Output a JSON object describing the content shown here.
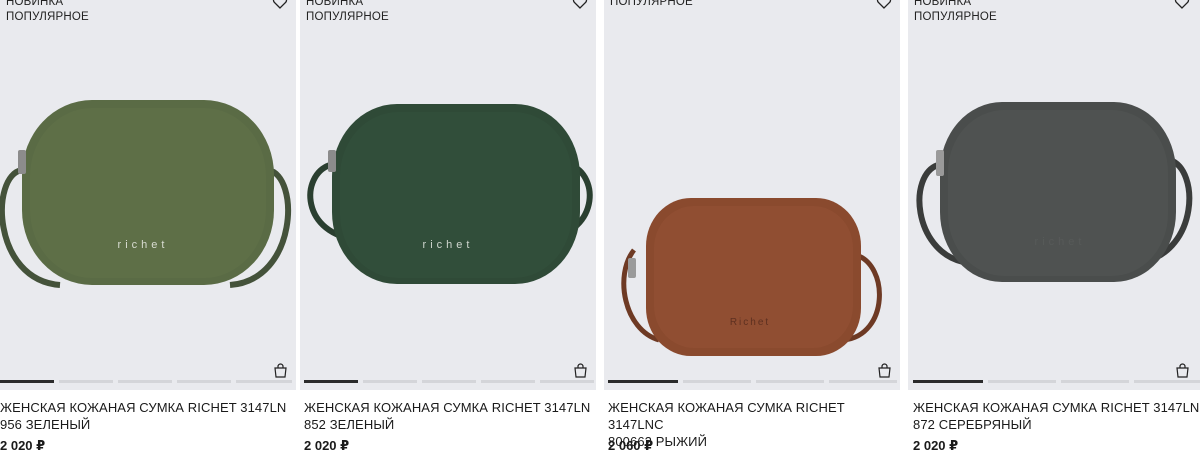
{
  "products": [
    {
      "badges": [
        "НОВИНКА",
        "ПОПУЛЯРНОЕ"
      ],
      "title_line1": "ЖЕНСКАЯ КОЖАНАЯ СУМКА RICHET 3147LN",
      "title_line2": "956 ЗЕЛЕНЫЙ",
      "price": "2 020 ₽",
      "bag_logo": "richet",
      "bag_color": "#5a6b45"
    },
    {
      "badges": [
        "НОВИНКА",
        "ПОПУЛЯРНОЕ"
      ],
      "title_line1": "ЖЕНСКАЯ КОЖАНАЯ СУМКА RICHET 3147LN",
      "title_line2": "852 ЗЕЛЕНЫЙ",
      "price": "2 020 ₽",
      "bag_logo": "richet",
      "bag_color": "#2f4a37"
    },
    {
      "badges": [
        "ПОПУЛЯРНОЕ"
      ],
      "title_line1": "ЖЕНСКАЯ КОЖАНАЯ СУМКА RICHET 3147LNC",
      "title_line2": "800662 РЫЖИЙ",
      "price": "2 060 ₽",
      "bag_logo": "Richet",
      "bag_color": "#8a4a2e"
    },
    {
      "badges": [
        "НОВИНКА",
        "ПОПУЛЯРНОЕ"
      ],
      "title_line1": "ЖЕНСКАЯ КОЖАНАЯ СУМКА RICHET 3147LN",
      "title_line2": "872 СЕРЕБРЯНЫЙ",
      "price": "2 020 ₽",
      "bag_logo": "richet",
      "bag_color": "#4a4d4c"
    }
  ],
  "icons": {
    "favorite": "heart-outline-icon",
    "cart": "shopping-bag-icon"
  }
}
